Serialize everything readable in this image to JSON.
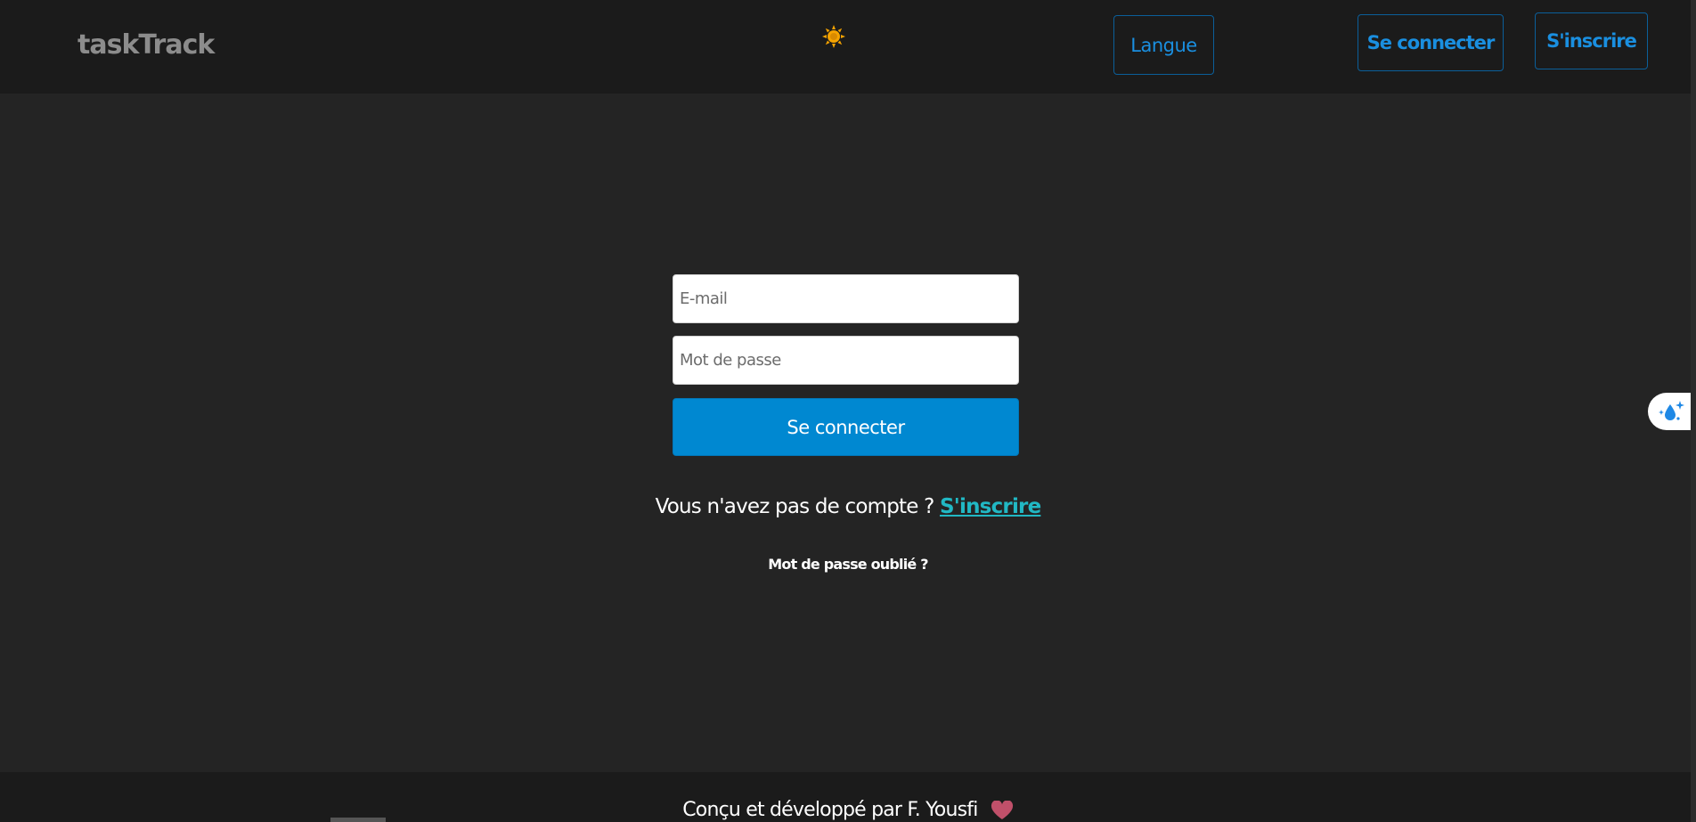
{
  "header": {
    "brand": "taskTrack",
    "theme_icon": "sun-icon",
    "language_label": "Langue",
    "login_label": "Se connecter",
    "signup_label": "S'inscrire"
  },
  "form": {
    "email_placeholder": "E-mail",
    "password_placeholder": "Mot de passe",
    "submit_label": "Se connecter",
    "no_account_text": "Vous n'avez pas de compte ?",
    "signup_link": "S'inscrire",
    "forgot_password": "Mot de passe oublié ?"
  },
  "widget": {
    "icon": "droplet-sparkle-icon"
  },
  "footer": {
    "credit": "Conçu et développé par F. Yousfi",
    "heart_icon": "heart-icon"
  },
  "colors": {
    "background": "#242424",
    "header_bg": "#1b1b1b",
    "accent": "#0088d1",
    "link": "#21b8c4",
    "brand": "#8c8c8c",
    "sun": "#f5a300",
    "heart": "#c0506a"
  }
}
